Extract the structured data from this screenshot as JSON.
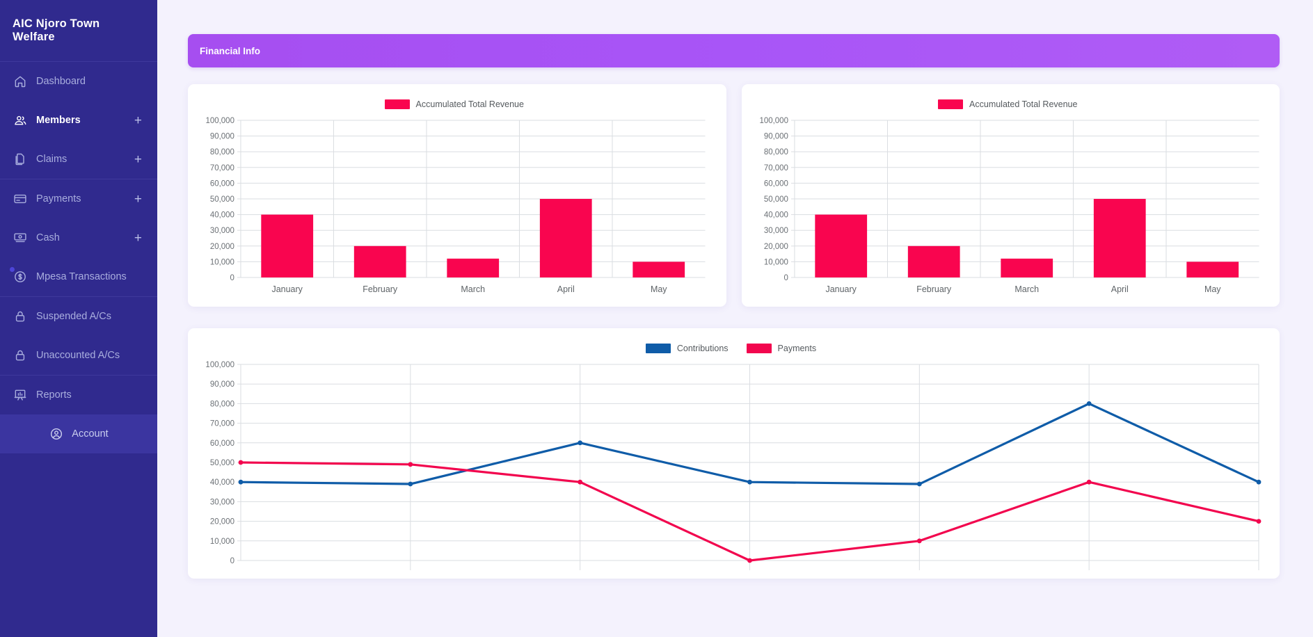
{
  "sidebar": {
    "brand": "AIC Njoro Town Welfare",
    "items": [
      {
        "label": "Dashboard",
        "icon": "home-icon",
        "expandable": false,
        "active": false,
        "strong": false,
        "dot": false
      },
      {
        "label": "Members",
        "icon": "users-icon",
        "expandable": true,
        "expand_label": "+",
        "active": false,
        "strong": true,
        "dot": false
      },
      {
        "label": "Claims",
        "icon": "documents-icon",
        "expandable": true,
        "expand_label": "+",
        "active": false,
        "strong": false,
        "dot": false
      },
      {
        "label": "Payments",
        "icon": "credit-card-icon",
        "expandable": true,
        "expand_label": "+",
        "active": false,
        "strong": false,
        "dot": false
      },
      {
        "label": "Cash",
        "icon": "banknote-icon",
        "expandable": true,
        "expand_label": "+",
        "active": false,
        "strong": false,
        "dot": false
      },
      {
        "label": "Mpesa Transactions",
        "icon": "dollar-circle-icon",
        "expandable": false,
        "active": false,
        "strong": false,
        "dot": true
      },
      {
        "label": "Suspended A/Cs",
        "icon": "lock-icon",
        "expandable": false,
        "active": false,
        "strong": false,
        "dot": false
      },
      {
        "label": "Unaccounted A/Cs",
        "icon": "lock-icon",
        "expandable": false,
        "active": false,
        "strong": false,
        "dot": false
      },
      {
        "label": "Reports",
        "icon": "presentation-chart-icon",
        "expandable": false,
        "active": false,
        "strong": false,
        "dot": false
      },
      {
        "label": "Account",
        "icon": "user-circle-icon",
        "expandable": false,
        "active": true,
        "strong": false,
        "dot": false
      }
    ]
  },
  "header": {
    "title": "Financial Info",
    "accent": "#a855f7"
  },
  "colors": {
    "sidebar_bg": "#302a8e",
    "sidebar_active": "#3b35a0",
    "page_bg": "#f4f2fd",
    "revenue_pink": "#f9054f",
    "payments_pink": "#f2064e",
    "contributions_blue": "#0f5ca8",
    "grid": "#dadde1",
    "axis_text": "#6b7075"
  },
  "chart_data": [
    {
      "id": "revenue-chart-left",
      "type": "bar",
      "title": "",
      "categories": [
        "January",
        "February",
        "March",
        "April",
        "May"
      ],
      "series": [
        {
          "name": "Accumulated Total Revenue",
          "color": "#f9054f",
          "values": [
            40000,
            20000,
            12000,
            50000,
            10000
          ]
        }
      ],
      "ylabel": "",
      "xlabel": "",
      "ylim": [
        0,
        100000
      ],
      "yticks": [
        0,
        10000,
        20000,
        30000,
        40000,
        50000,
        60000,
        70000,
        80000,
        90000,
        100000
      ],
      "ytick_labels": [
        "0",
        "10,000",
        "20,000",
        "30,000",
        "40,000",
        "50,000",
        "60,000",
        "70,000",
        "80,000",
        "90,000",
        "100,000"
      ],
      "grid": true,
      "legend_position": "top-center"
    },
    {
      "id": "revenue-chart-right",
      "type": "bar",
      "title": "",
      "categories": [
        "January",
        "February",
        "March",
        "April",
        "May"
      ],
      "series": [
        {
          "name": "Accumulated Total Revenue",
          "color": "#f9054f",
          "values": [
            40000,
            20000,
            12000,
            50000,
            10000
          ]
        }
      ],
      "ylabel": "",
      "xlabel": "",
      "ylim": [
        0,
        100000
      ],
      "yticks": [
        0,
        10000,
        20000,
        30000,
        40000,
        50000,
        60000,
        70000,
        80000,
        90000,
        100000
      ],
      "ytick_labels": [
        "0",
        "10,000",
        "20,000",
        "30,000",
        "40,000",
        "50,000",
        "60,000",
        "70,000",
        "80,000",
        "90,000",
        "100,000"
      ],
      "grid": true,
      "legend_position": "top-center"
    },
    {
      "id": "contributions-payments-chart",
      "type": "line",
      "title": "",
      "x": [
        1,
        2,
        3,
        4,
        5,
        6,
        7
      ],
      "categories": [
        "",
        "",
        "",
        "",
        "",
        "",
        ""
      ],
      "series": [
        {
          "name": "Contributions",
          "color": "#0f5ca8",
          "values": [
            40000,
            39000,
            60000,
            40000,
            39000,
            80000,
            40000
          ]
        },
        {
          "name": "Payments",
          "color": "#f2064e",
          "values": [
            50000,
            49000,
            40000,
            0,
            10000,
            40000,
            20000
          ]
        }
      ],
      "ylabel": "",
      "xlabel": "",
      "ylim": [
        0,
        100000
      ],
      "yticks": [
        0,
        10000,
        20000,
        30000,
        40000,
        50000,
        60000,
        70000,
        80000,
        90000,
        100000
      ],
      "ytick_labels": [
        "0",
        "10,000",
        "20,000",
        "30,000",
        "40,000",
        "50,000",
        "60,000",
        "70,000",
        "80,000",
        "90,000",
        "100,000"
      ],
      "grid": true,
      "legend_position": "top-center",
      "markers": true
    }
  ]
}
